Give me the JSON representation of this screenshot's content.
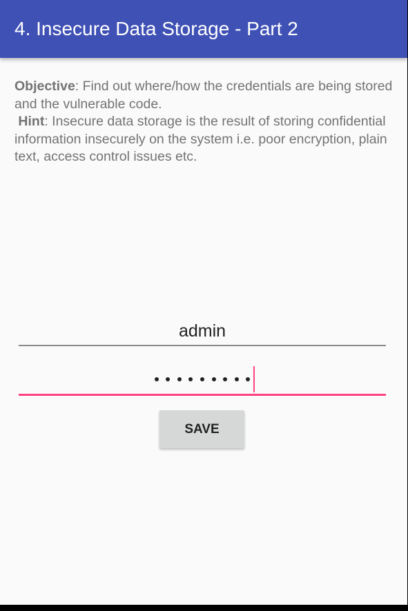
{
  "appbar": {
    "title": "4. Insecure Data Storage - Part 2",
    "color": "#3f51b5"
  },
  "description": {
    "objective_label": "Objective",
    "objective_text": ": Find out where/how the credentials are being stored and the vulnerable code.",
    "hint_label": "Hint",
    "hint_text": ": Insecure data storage is the result of storing confidential information insecurely on the system i.e. poor encryption, plain text, access control issues etc."
  },
  "form": {
    "username_value": "admin",
    "password_dot_count": 9,
    "password_focused": true,
    "accent_color": "#ff4081",
    "save_label": "SAVE"
  }
}
